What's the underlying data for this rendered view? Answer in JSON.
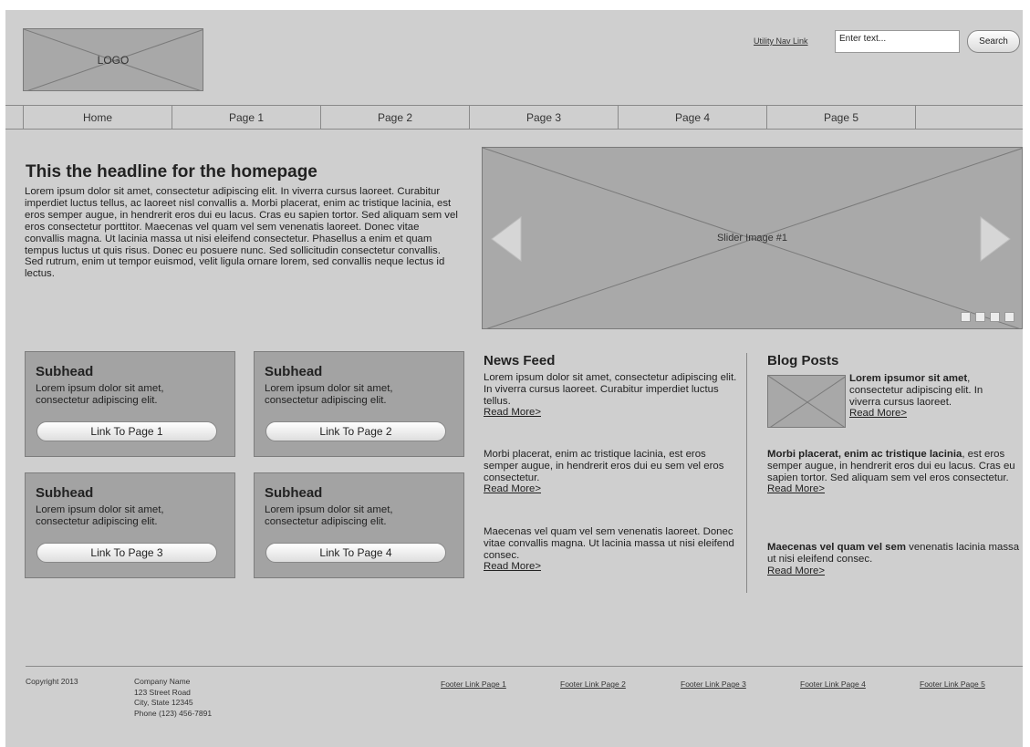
{
  "header": {
    "logo_label": "LOGO",
    "utility_link": "Utility Nav Link",
    "search_value": "Enter text...",
    "search_button": "Search"
  },
  "nav": {
    "items": [
      "Home",
      "Page 1",
      "Page 2",
      "Page 3",
      "Page 4",
      "Page 5",
      ""
    ]
  },
  "intro": {
    "headline": "This the headline for the homepage",
    "body": "Lorem ipsum dolor sit amet, consectetur adipiscing elit. In viverra cursus laoreet. Curabitur imperdiet luctus tellus, ac laoreet nisl convallis a. Morbi placerat, enim ac tristique lacinia, est eros semper augue, in hendrerit eros dui eu lacus. Cras eu sapien tortor. Sed aliquam sem vel eros consectetur porttitor. Maecenas vel quam vel sem venenatis laoreet. Donec vitae convallis magna. Ut lacinia massa ut nisi eleifend consectetur. Phasellus a enim et quam tempus luctus ut quis risus. Donec eu posuere nunc. Sed sollicitudin consectetur convallis. Sed rutrum, enim ut tempor euismod, velit ligula ornare lorem, sed convallis neque lectus id lectus."
  },
  "slider": {
    "label": "Slider Image #1",
    "slide_count": 4
  },
  "tiles": [
    {
      "subhead": "Subhead",
      "text": "Lorem ipsum dolor sit amet, consectetur adipiscing elit.",
      "button": "Link To Page 1"
    },
    {
      "subhead": "Subhead",
      "text": "Lorem ipsum dolor sit amet, consectetur adipiscing elit.",
      "button": "Link To Page 2"
    },
    {
      "subhead": "Subhead",
      "text": "Lorem ipsum dolor sit amet, consectetur adipiscing elit.",
      "button": "Link To Page 3"
    },
    {
      "subhead": "Subhead",
      "text": "Lorem ipsum dolor sit amet, consectetur adipiscing elit.",
      "button": "Link To Page 4"
    }
  ],
  "news": {
    "title": "News Feed",
    "items": [
      {
        "text": "Lorem ipsum dolor sit amet, consectetur adipiscing elit. In viverra cursus laoreet. Curabitur imperdiet luctus tellus.",
        "more": "Read More>"
      },
      {
        "text": "Morbi placerat, enim ac tristique lacinia, est eros semper augue, in hendrerit eros dui eu sem vel eros consectetur.",
        "more": "Read More>"
      },
      {
        "text": "Maecenas vel quam vel sem venenatis laoreet. Donec vitae convallis magna. Ut lacinia massa ut nisi eleifend consec.",
        "more": "Read More>"
      }
    ]
  },
  "blog": {
    "title": "Blog Posts",
    "items": [
      {
        "bold": "Lorem ipsumor sit amet",
        "text": ", consectetur adipiscing elit. In viverra cursus laoreet.",
        "more": "Read More>"
      },
      {
        "bold": "Morbi placerat, enim ac tristique lacinia",
        "text": ", est eros semper augue, in hendrerit eros dui eu lacus. Cras eu sapien tortor. Sed aliquam sem vel eros consectetur.",
        "more": "Read More>"
      },
      {
        "bold": "Maecenas vel quam vel sem",
        "text": " venenatis lacinia massa ut nisi eleifend consec.",
        "more": "Read More>"
      }
    ]
  },
  "footer": {
    "copyright": "Copyright 2013",
    "company": "Company Name",
    "street": "123 Street Road",
    "city": "City, State 12345",
    "phone": "Phone (123) 456-7891",
    "links": [
      "Footer Link Page 1",
      "Footer Link Page 2",
      "Footer Link Page 3",
      "Footer Link Page 4",
      "Footer Link Page 5"
    ]
  }
}
